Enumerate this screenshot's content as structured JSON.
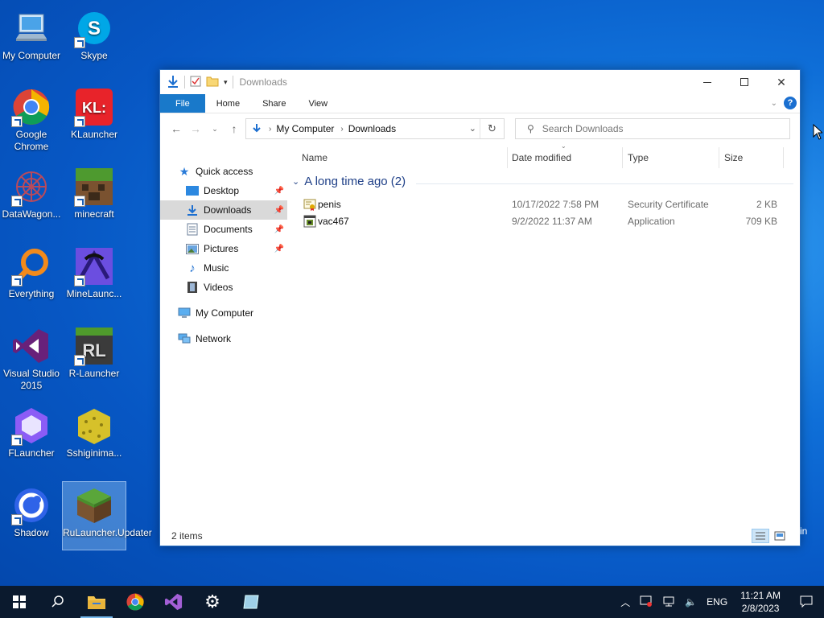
{
  "desktop": {
    "icons": [
      {
        "label": "My Computer",
        "icon": "computer-icon"
      },
      {
        "label": "Skype",
        "icon": "skype-icon"
      },
      {
        "label": "Google Chrome",
        "icon": "chrome-icon"
      },
      {
        "label": "KLauncher",
        "icon": "klauncher-icon"
      },
      {
        "label": "DataWagon...",
        "icon": "datawagon-icon"
      },
      {
        "label": "minecraft",
        "icon": "minecraft-icon"
      },
      {
        "label": "Everything",
        "icon": "everything-icon"
      },
      {
        "label": "MineLaunc...",
        "icon": "minelauncher-icon"
      },
      {
        "label": "Visual Studio 2015",
        "icon": "visual-studio-icon"
      },
      {
        "label": "R-Launcher",
        "icon": "rlauncher-icon"
      },
      {
        "label": "FLauncher",
        "icon": "flauncher-icon"
      },
      {
        "label": "Sshiginima...",
        "icon": "sponge-icon"
      },
      {
        "label": "Shadow",
        "icon": "shadow-icon"
      },
      {
        "label": "RuLauncher.Updater",
        "icon": "grass-block-icon"
      }
    ]
  },
  "window": {
    "title": "Downloads",
    "ribbon": {
      "file": "File",
      "home": "Home",
      "share": "Share",
      "view": "View"
    },
    "address": {
      "root": "My Computer",
      "current": "Downloads"
    },
    "search_placeholder": "Search Downloads",
    "nav": {
      "quick_access": "Quick access",
      "desktop": "Desktop",
      "downloads": "Downloads",
      "documents": "Documents",
      "pictures": "Pictures",
      "music": "Music",
      "videos": "Videos",
      "my_computer": "My Computer",
      "network": "Network"
    },
    "columns": {
      "name": "Name",
      "date": "Date modified",
      "type": "Type",
      "size": "Size"
    },
    "group_label": "A long time ago (2)",
    "files": [
      {
        "name": "penis",
        "date": "10/17/2022 7:58 PM",
        "type": "Security Certificate",
        "size": "2 KB",
        "icon": "certificate-icon"
      },
      {
        "name": "vac467",
        "date": "9/2/2022 11:37 AM",
        "type": "Application",
        "size": "709 KB",
        "icon": "application-icon"
      }
    ],
    "status": "2 items",
    "partial_text": "in"
  },
  "taskbar": {
    "lang": "ENG",
    "time": "11:21 AM",
    "date": "2/8/2023"
  }
}
